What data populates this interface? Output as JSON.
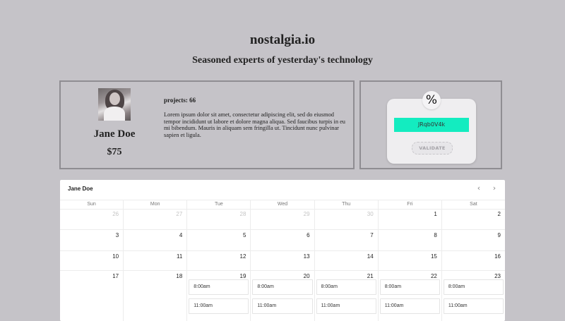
{
  "site": {
    "title": "nostalgia.io",
    "subtitle": "Seasoned experts of yesterday's technology"
  },
  "profile": {
    "name": "Jane Doe",
    "price": "$75",
    "projects": "projects: 66",
    "bio": "Lorem ipsum dolor sit amet, consectetur adipiscing elit, sed do eiusmod tempor incididunt ut labore et dolore magna aliqua. Sed faucibus turpis in eu mi bibendum. Mauris in aliquam sem fringilla ut. Tincidunt nunc pulvinar sapien et ligula."
  },
  "coupon": {
    "icon": "percent-icon",
    "symbol": "%",
    "code": "JRqb0V4k",
    "validate_label": "VALIDATE",
    "accent_color": "#13ecc0"
  },
  "calendar": {
    "title": "Jane Doe",
    "prev_symbol": "‹",
    "next_symbol": "›",
    "weekdays": [
      "Sun",
      "Mon",
      "Tue",
      "Wed",
      "Thu",
      "Fri",
      "Sat"
    ],
    "weeks": [
      [
        {
          "day": "26",
          "outside": true
        },
        {
          "day": "27",
          "outside": true
        },
        {
          "day": "28",
          "outside": true
        },
        {
          "day": "29",
          "outside": true
        },
        {
          "day": "30",
          "outside": true
        },
        {
          "day": "1"
        },
        {
          "day": "2"
        }
      ],
      [
        {
          "day": "3"
        },
        {
          "day": "4"
        },
        {
          "day": "5"
        },
        {
          "day": "6"
        },
        {
          "day": "7"
        },
        {
          "day": "8"
        },
        {
          "day": "9"
        }
      ],
      [
        {
          "day": "10"
        },
        {
          "day": "11"
        },
        {
          "day": "12"
        },
        {
          "day": "13"
        },
        {
          "day": "14"
        },
        {
          "day": "15"
        },
        {
          "day": "16"
        }
      ],
      [
        {
          "day": "17"
        },
        {
          "day": "18"
        },
        {
          "day": "19",
          "slots": [
            "8:00am",
            "11:00am"
          ]
        },
        {
          "day": "20",
          "slots": [
            "8:00am",
            "11:00am"
          ]
        },
        {
          "day": "21",
          "slots": [
            "8:00am",
            "11:00am"
          ]
        },
        {
          "day": "22",
          "slots": [
            "8:00am",
            "11:00am"
          ]
        },
        {
          "day": "23",
          "slots": [
            "8:00am",
            "11:00am"
          ]
        }
      ]
    ]
  }
}
